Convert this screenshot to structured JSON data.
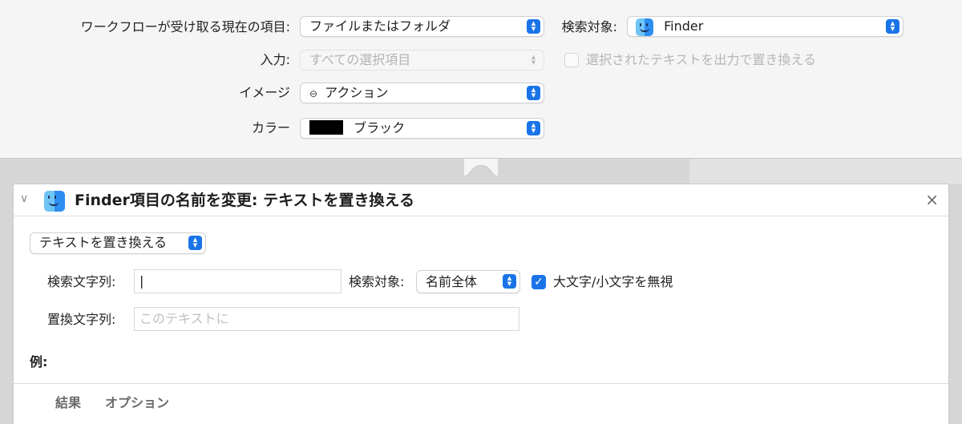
{
  "workflow": {
    "receives_label": "ワークフローが受け取る現在の項目:",
    "receives_value": "ファイルまたはフォルダ",
    "in_label": "検索対象:",
    "in_app": "Finder",
    "input_label": "入力:",
    "input_value": "すべての選択項目",
    "replace_checkbox_label": "選択されたテキストを出力で置き換える",
    "image_label": "イメージ",
    "image_value": "アクション",
    "image_glyph": "⊖",
    "color_label": "カラー",
    "color_value": "ブラック",
    "color_swatch": "#000000"
  },
  "action": {
    "title": "Finder項目の名前を変更: テキストを置き換える",
    "mode_value": "テキストを置き換える",
    "find_label": "検索文字列:",
    "find_value": "|",
    "search_in_label": "検索対象:",
    "search_in_value": "名前全体",
    "ignore_case_label": "大文字/小文字を無視",
    "ignore_case_checked": true,
    "replace_label": "置換文字列:",
    "replace_placeholder": "このテキストに",
    "example_label": "例:",
    "tabs": [
      "結果",
      "オプション"
    ],
    "close_glyph": "×",
    "collapse_glyph": "∨",
    "check_glyph": "✓"
  },
  "colors": {
    "accent": "#1a74e8"
  }
}
